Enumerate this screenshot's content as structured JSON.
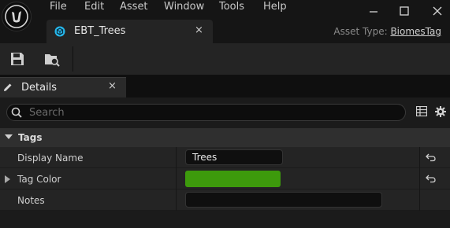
{
  "menu": {
    "items": [
      "File",
      "Edit",
      "Asset",
      "Window",
      "Tools",
      "Help"
    ]
  },
  "window_controls": {
    "minimize_icon": "minimize-icon",
    "maximize_icon": "maximize-icon",
    "close_icon": "close-icon"
  },
  "document_tab": {
    "label": "EBT_Trees",
    "close": "×"
  },
  "asset_type": {
    "prefix": "Asset Type: ",
    "value": "BiomesTag"
  },
  "toolbar": {
    "save_icon": "save-icon",
    "browse_icon": "browse-to-asset-icon"
  },
  "details_tab": {
    "label": "Details",
    "close": "×"
  },
  "details": {
    "search_placeholder": "Search",
    "category": "Tags",
    "rows": [
      {
        "label": "Display Name",
        "value": "Trees"
      },
      {
        "label": "Tag Color",
        "color": "#3d9a0c"
      },
      {
        "label": "Notes",
        "value": ""
      }
    ]
  },
  "colors": {
    "tag_color": "#3d9a0c",
    "accent": "#26b8ec"
  }
}
